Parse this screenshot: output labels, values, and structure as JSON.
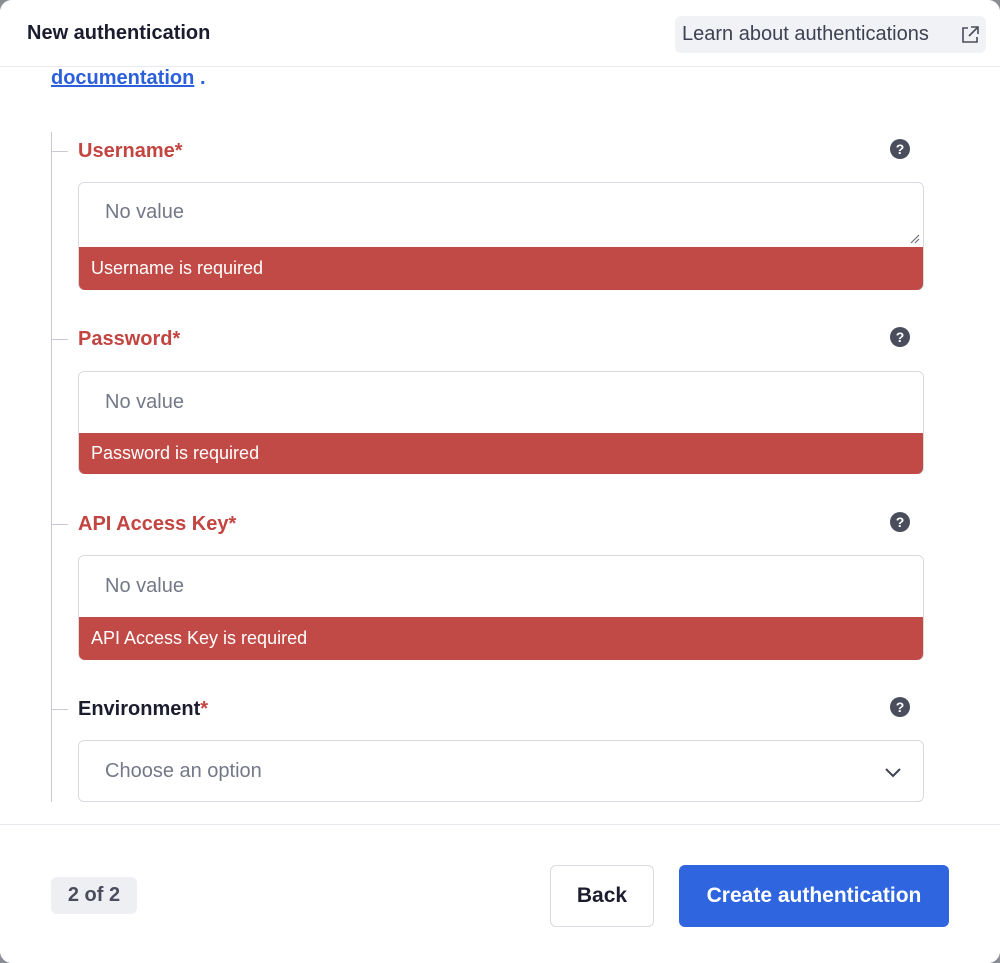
{
  "header": {
    "title": "New authentication",
    "learn_link": "Learn about authentications"
  },
  "intro": {
    "doc_link": "documentation",
    "doc_period": "."
  },
  "fields": {
    "username": {
      "label": "Username",
      "required_mark": "*",
      "placeholder": "No value",
      "error": "Username is required"
    },
    "password": {
      "label": "Password",
      "required_mark": "*",
      "placeholder": "No value",
      "error": "Password is required"
    },
    "api_key": {
      "label": "API Access Key",
      "required_mark": "*",
      "placeholder": "No value",
      "error": "API Access Key is required"
    },
    "environment": {
      "label": "Environment",
      "required_mark": "*",
      "placeholder": "Choose an option"
    }
  },
  "help_glyph": "?",
  "footer": {
    "step": "2 of 2",
    "back_label": "Back",
    "create_label": "Create authentication"
  },
  "colors": {
    "error": "#c24a46",
    "primary": "#2f66e0",
    "link": "#2b5fdb"
  },
  "icons": {
    "external": "external-link-icon",
    "help": "question-circle-icon",
    "dropdown": "chevron-down-icon"
  }
}
